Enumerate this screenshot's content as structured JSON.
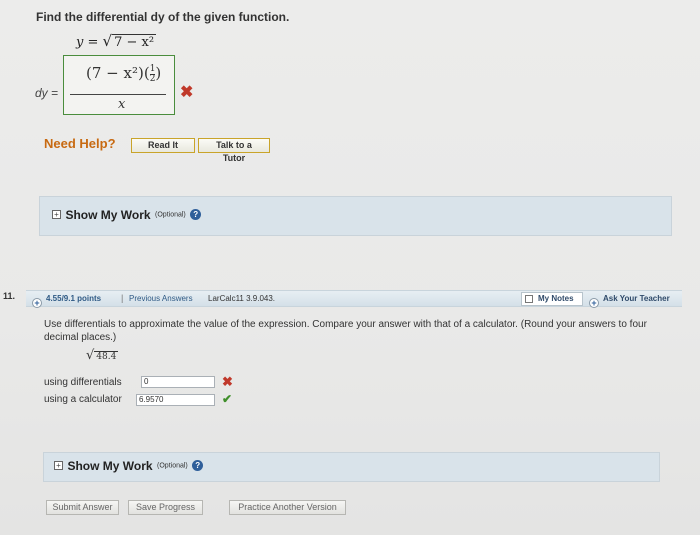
{
  "question10": {
    "prompt": "Find the differential dy of the given function.",
    "function_lhs": "y =",
    "function_radical": "√",
    "function_radicand": "7 − x²",
    "dy_label": "dy =",
    "answer_numerator": "(7 − x²)",
    "answer_power_num": "1",
    "answer_power_den": "2",
    "answer_denominator": "x",
    "status_mark": "✖",
    "need_help": "Need Help?",
    "read_it": "Read It",
    "talk_to_tutor": "Talk to a Tutor",
    "show_work": "Show My Work",
    "show_work_optional": "(Optional)",
    "help_icon": "?"
  },
  "question11": {
    "number": "11.",
    "points": "4.55/9.1 points",
    "separator": "|",
    "previous_answers": "Previous Answers",
    "problem_id": "LarCalc11 3.9.043.",
    "my_notes": "My Notes",
    "ask_teacher": "Ask Your Teacher",
    "prompt": "Use differentials to approximate the value of the expression. Compare your answer with that of a calculator. (Round your answers to four decimal places.)",
    "radical": "√",
    "radicand": "48.4",
    "differentials_label": "using differentials",
    "differentials_value": "0",
    "differentials_mark": "✖",
    "calculator_label": "using a calculator",
    "calculator_value": "6.9570",
    "calculator_mark": "✔",
    "show_work": "Show My Work",
    "show_work_optional": "(Optional)",
    "help_icon": "?"
  },
  "footer": {
    "submit": "Submit Answer",
    "save": "Save Progress",
    "practice": "Practice Another Version"
  },
  "colors": {
    "need_help": "#c86a12",
    "wrong": "#c0392b",
    "correct": "#3f8f2a",
    "panel": "#d9e3ea",
    "link_blue": "#2f5a85"
  }
}
